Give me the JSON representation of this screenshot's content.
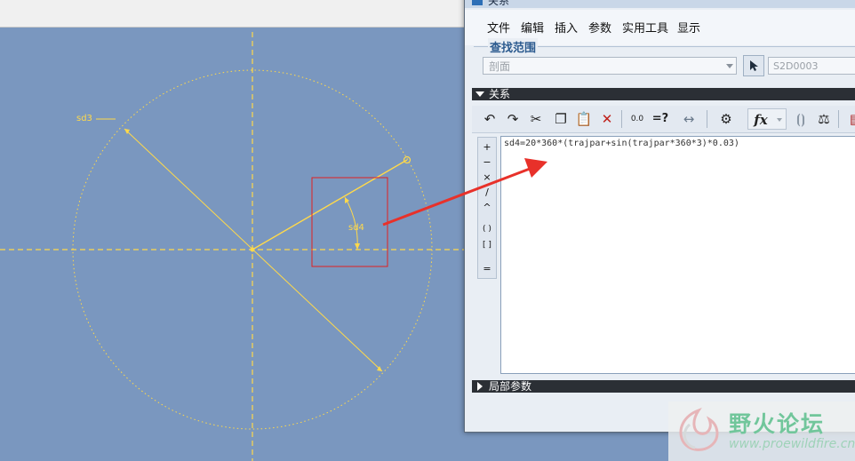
{
  "dialog": {
    "title": "关系",
    "menu": [
      "文件",
      "编辑",
      "插入",
      "参数",
      "实用工具",
      "显示"
    ],
    "lookup": {
      "label": "查找范围",
      "scope_value": "剖面",
      "name_value": "S2D0003"
    },
    "relations_header": "关系",
    "toolbar_icons": [
      "undo-icon",
      "redo-icon",
      "cut-icon",
      "copy-icon",
      "paste-icon",
      "delete-icon",
      "value-switch-icon",
      "evaluate-icon",
      "dimension-icon",
      "verify-icon",
      "function-icon",
      "brackets-icon",
      "sort-icon",
      "table-icon"
    ],
    "toolbar_equals": "=?",
    "toolbar_fx": "fx",
    "operators": [
      "+",
      "−",
      "×",
      "/",
      "^",
      "( )",
      "[ ]",
      "="
    ],
    "relation_text": "sd4=20*360*(trajpar+sin(trajpar*360*3)*0.03)",
    "local_params_header": "局部参数"
  },
  "sketch": {
    "dim_sd3": "sd3",
    "dim_sd4": "sd4",
    "accent_color": "#ffd94a",
    "highlight_color": "#e02020"
  },
  "watermark": {
    "text": "野火论坛",
    "url": "www.proewildfire.cn"
  }
}
